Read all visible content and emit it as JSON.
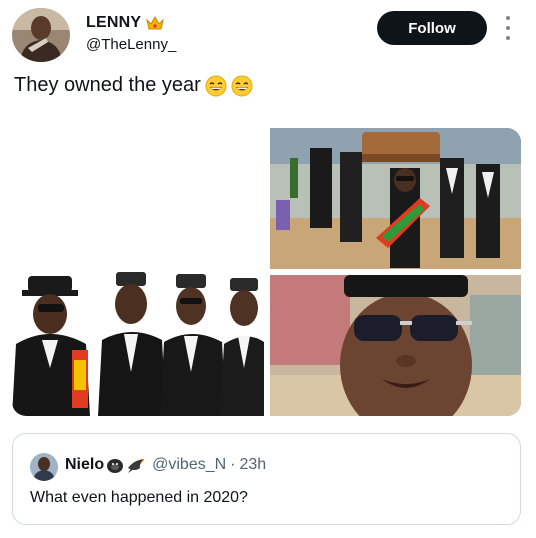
{
  "author": {
    "display_name": "LENNY",
    "handle": "@TheLenny_",
    "badge_icon": "crown-icon"
  },
  "actions": {
    "follow_label": "Follow",
    "more_icon": "more-vertical-icon"
  },
  "tweet": {
    "text": "They owned the year",
    "emojis": [
      "grinning-sweat-emoji",
      "grinning-sweat-emoji"
    ]
  },
  "media": {
    "images": [
      {
        "name": "pallbearers-posing-image"
      },
      {
        "name": "pallbearers-dancing-coffin-image"
      },
      {
        "name": "pallbearer-sunglasses-closeup-image"
      }
    ]
  },
  "quote": {
    "display_name": "Nielo",
    "badge_icons": [
      "gorilla-emoji",
      "bird-emoji"
    ],
    "handle": "@vibes_N",
    "separator": "·",
    "time": "23h",
    "text": "What even happened in 2020?"
  },
  "colors": {
    "text": "#0f1419",
    "secondary": "#536471",
    "follow_bg": "#0f1419",
    "border": "#cfd9de"
  }
}
